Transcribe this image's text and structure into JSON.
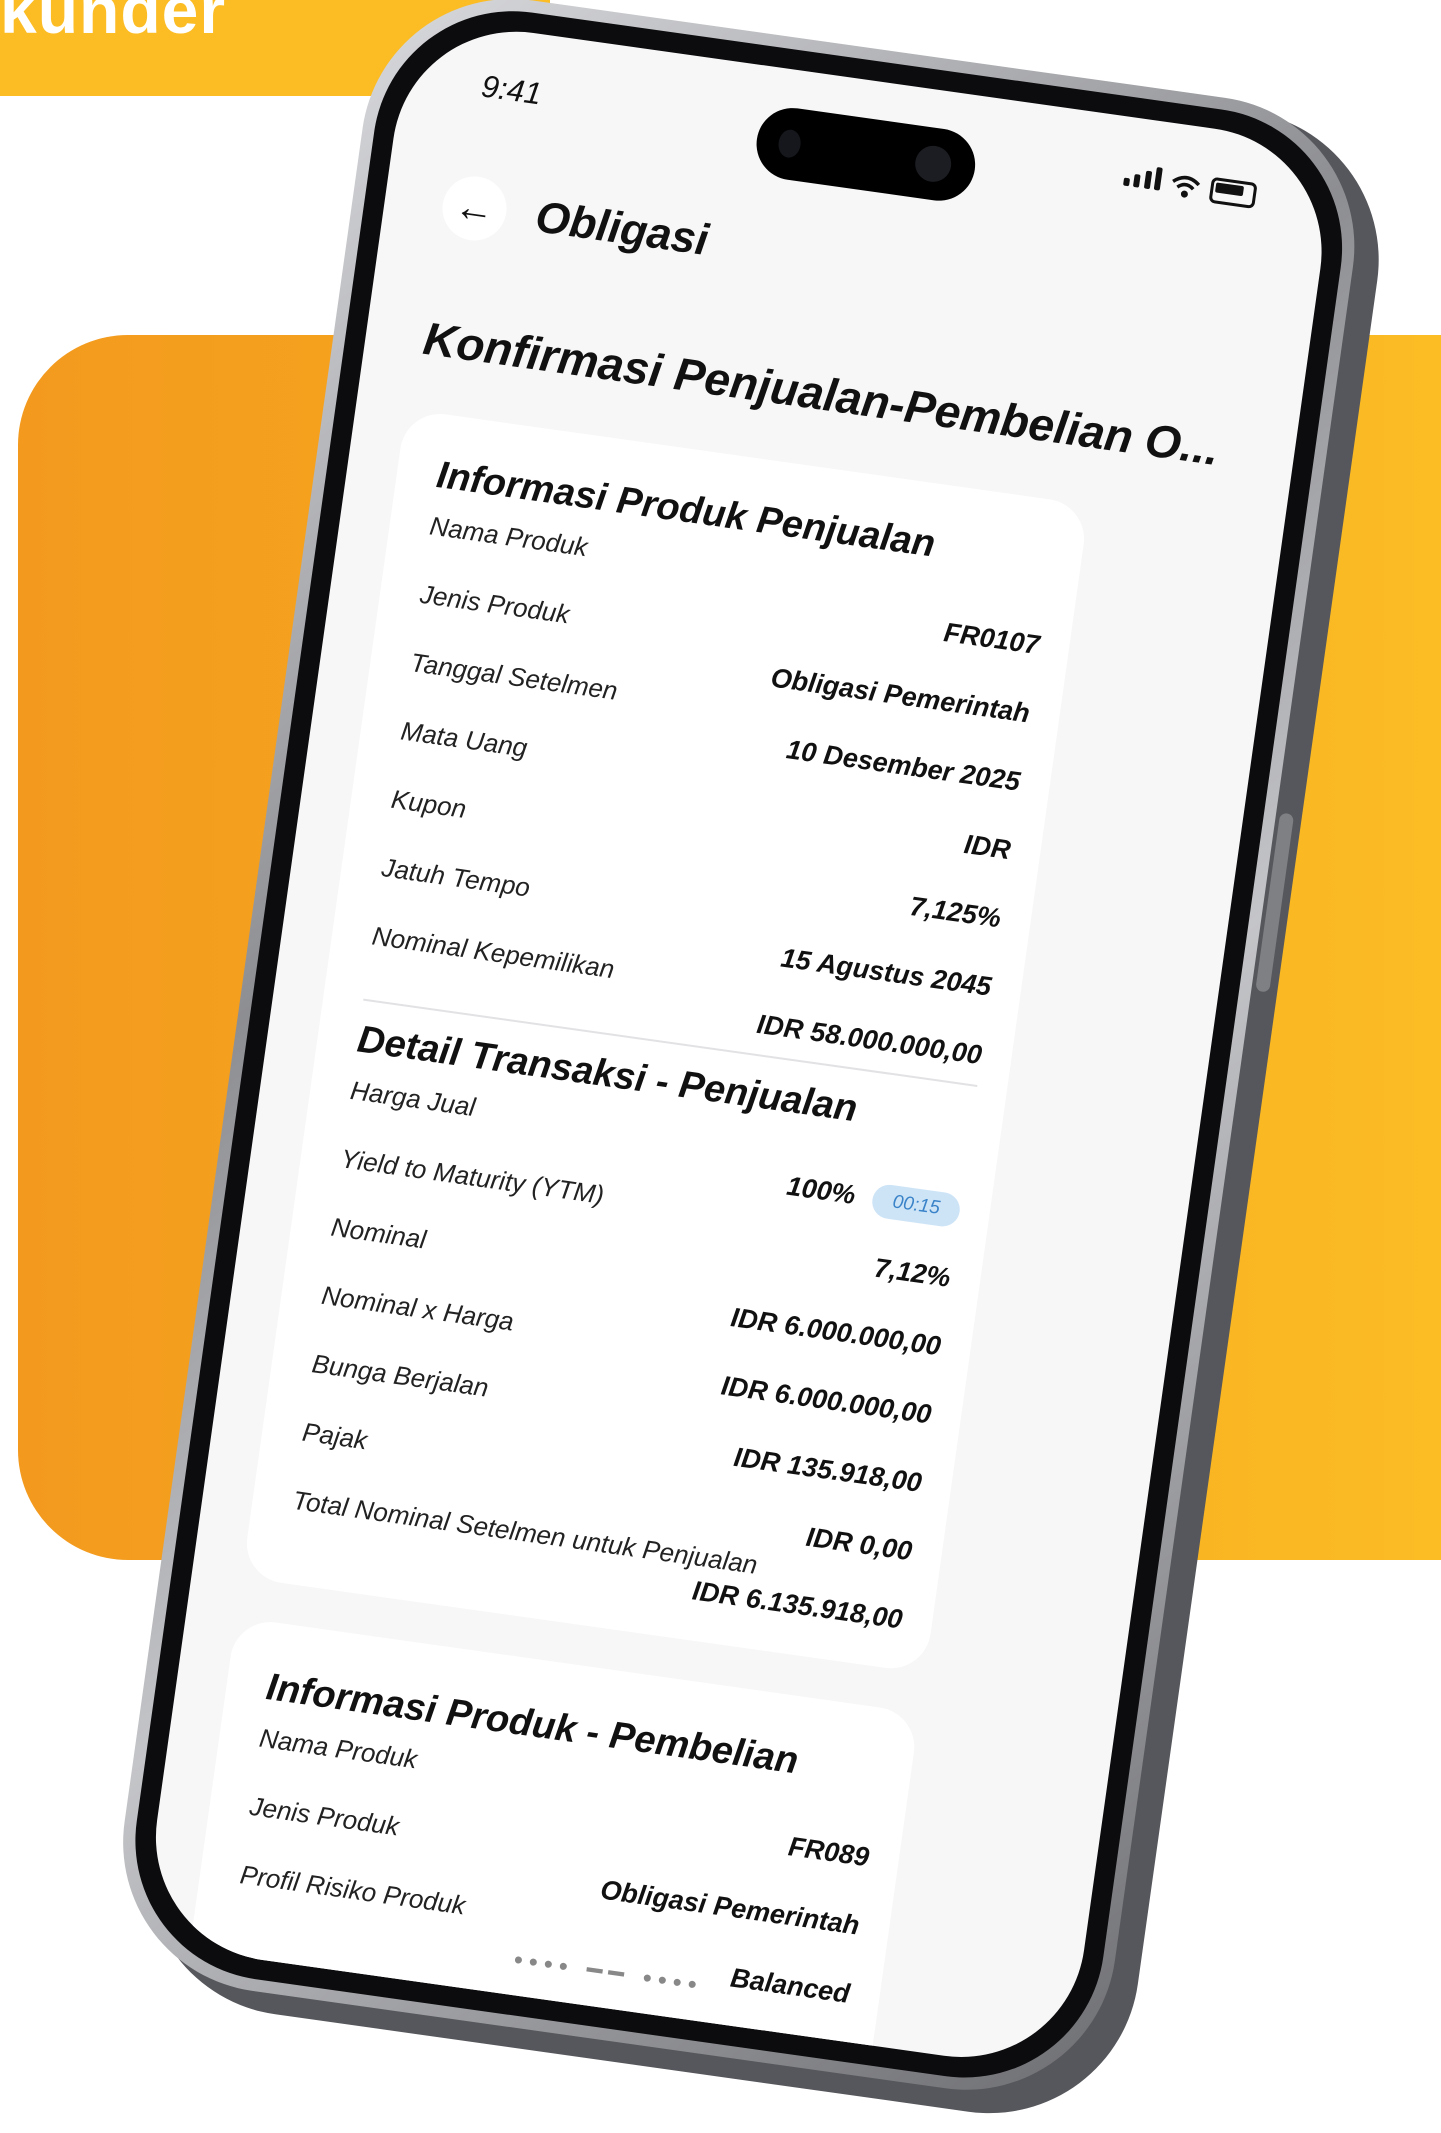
{
  "banner": {
    "text": "kunder"
  },
  "status": {
    "time": "9:41"
  },
  "header": {
    "back_icon": "arrow-left-icon",
    "title": "Obligasi"
  },
  "page_title": "Konfirmasi Penjualan-Pembelian O...",
  "sale_product": {
    "title": "Informasi Produk Penjualan",
    "rows": [
      {
        "label": "Nama Produk",
        "value": "FR0107"
      },
      {
        "label": "Jenis Produk",
        "value": "Obligasi Pemerintah"
      },
      {
        "label": "Tanggal Setelmen",
        "value": "10 Desember 2025"
      },
      {
        "label": "Mata Uang",
        "value": "IDR"
      },
      {
        "label": "Kupon",
        "value": "7,125%"
      },
      {
        "label": "Jatuh Tempo",
        "value": "15 Agustus 2045"
      },
      {
        "label": "Nominal Kepemilikan",
        "value": "IDR 58.000.000,00"
      }
    ]
  },
  "sale_detail": {
    "title": "Detail Transaksi - Penjualan",
    "rows": [
      {
        "label": "Harga Jual",
        "value": "100%",
        "badge": "00:15"
      },
      {
        "label": "Yield to Maturity (YTM)",
        "value": "7,12%"
      },
      {
        "label": "Nominal",
        "value": "IDR 6.000.000,00"
      },
      {
        "label": "Nominal x Harga",
        "value": "IDR 6.000.000,00"
      },
      {
        "label": "Bunga Berjalan",
        "value": "IDR 135.918,00"
      },
      {
        "label": "Pajak",
        "value": "IDR 0,00"
      },
      {
        "label": "Total Nominal Setelmen untuk Penjualan",
        "value": "IDR 6.135.918,00"
      }
    ]
  },
  "buy_product": {
    "title": "Informasi Produk - Pembelian",
    "rows": [
      {
        "label": "Nama Produk",
        "value": "FR089"
      },
      {
        "label": "Jenis Produk",
        "value": "Obligasi Pemerintah"
      },
      {
        "label": "Profil Risiko Produk",
        "value": "Balanced"
      }
    ]
  }
}
